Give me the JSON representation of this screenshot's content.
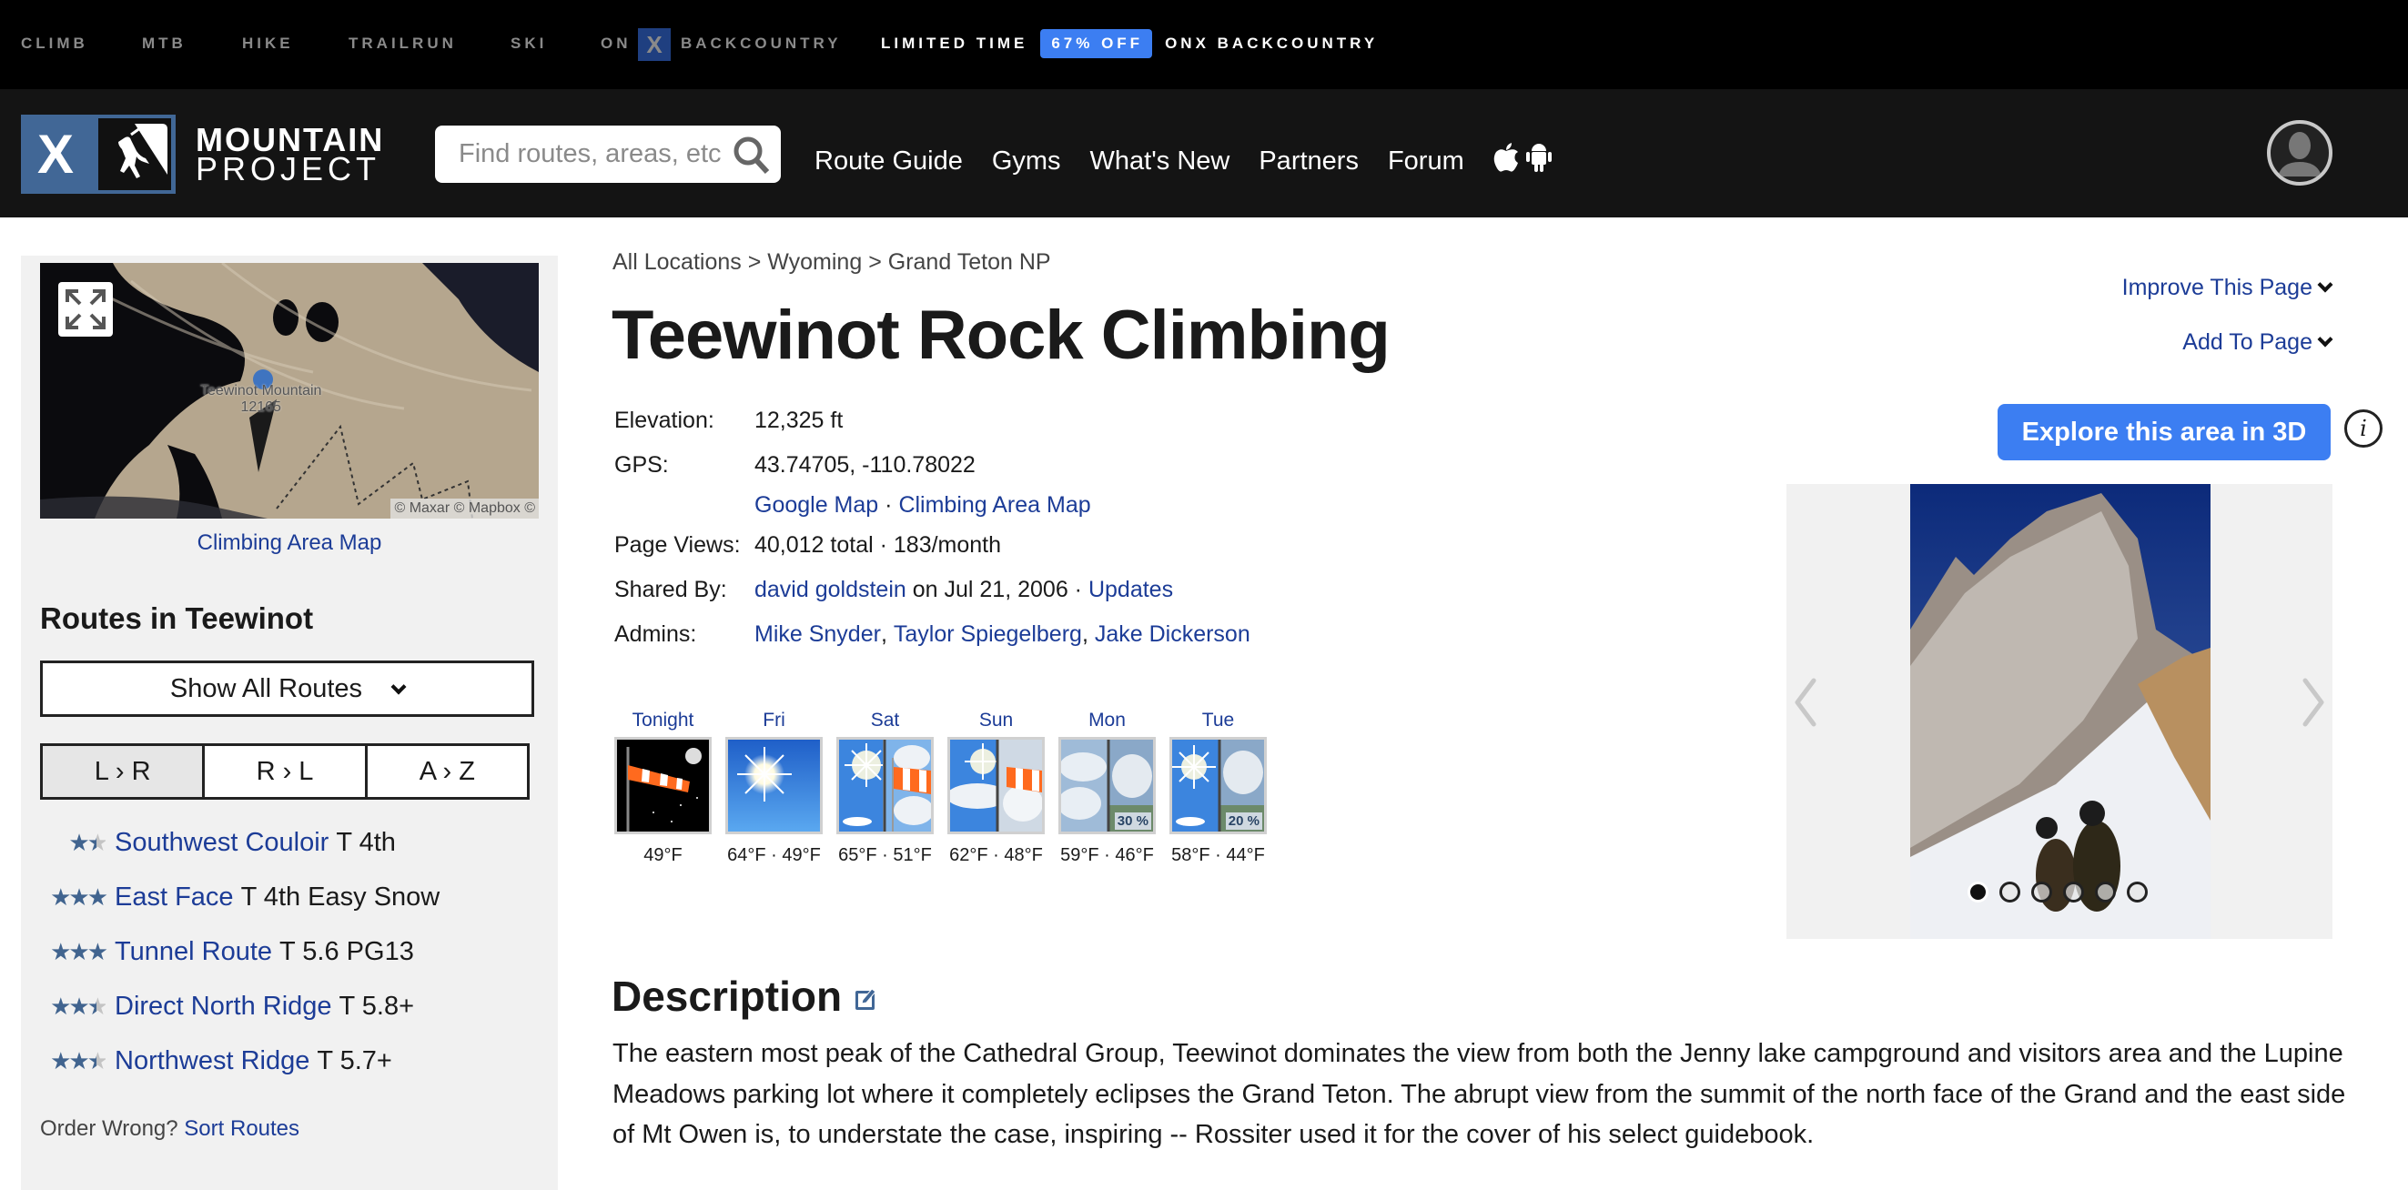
{
  "topbar": {
    "links": [
      "CLIMB",
      "MTB",
      "HIKE",
      "TRAILRUN",
      "SKI"
    ],
    "onx_prefix": "ON",
    "onx_logo": "X",
    "onx_suffix": "BACKCOUNTRY",
    "promo": {
      "before": "LIMITED TIME",
      "badge": "67% OFF",
      "after": "ONX BACKCOUNTRY"
    },
    "promo_badge_color": "#3c7ef2"
  },
  "header": {
    "logo_line1": "MOUNTAIN",
    "logo_line2": "PROJECT",
    "logo_x": "X",
    "search_placeholder": "Find routes, areas, etc",
    "search_value": "",
    "nav": [
      "Route Guide",
      "Gyms",
      "What's New",
      "Partners",
      "Forum"
    ],
    "app_icons": [
      "apple-icon",
      "android-icon"
    ]
  },
  "sidebar": {
    "map_label": "Teewinot Mountain",
    "map_label_elev": "12165",
    "map_attribution": "© Maxar © Mapbox ©",
    "map_link": "Climbing Area Map",
    "routes_heading": "Routes in Teewinot",
    "show_all": "Show All Routes",
    "sort_tabs": [
      "L › R",
      "R › L",
      "A › Z"
    ],
    "sort_active": 0,
    "routes": [
      {
        "name": "Southwest Couloir",
        "grade": "T 4th",
        "stars": 1.5
      },
      {
        "name": "East Face",
        "grade": "T 4th Easy Snow",
        "stars": 3
      },
      {
        "name": "Tunnel Route",
        "grade": "T 5.6 PG13",
        "stars": 3
      },
      {
        "name": "Direct North Ridge",
        "grade": "T 5.8+",
        "stars": 2.5
      },
      {
        "name": "Northwest Ridge",
        "grade": "T 5.7+",
        "stars": 2.5
      }
    ],
    "order_wrong": "Order Wrong?",
    "sort_routes": "Sort Routes"
  },
  "main": {
    "breadcrumb": [
      "All Locations",
      "Wyoming",
      "Grand Teton NP"
    ],
    "breadcrumb_sep": ">",
    "title": "Teewinot Rock Climbing",
    "improve": "Improve This Page",
    "add_to": "Add To Page",
    "explore_3d": "Explore this area in 3D",
    "info_icon": "i",
    "details": {
      "elevation_label": "Elevation:",
      "elevation": "12,325 ft",
      "gps_label": "GPS:",
      "gps": "43.74705, -110.78022",
      "google_map": "Google Map",
      "sep": "·",
      "climbing_map": "Climbing Area Map",
      "views_label": "Page Views:",
      "views": "40,012 total · 183/month",
      "shared_label": "Shared By:",
      "shared_user": "david goldstein",
      "shared_date": "on Jul 21, 2006 ·",
      "updates": "Updates",
      "admins_label": "Admins:",
      "admins": [
        "Mike Snyder",
        "Taylor Spiegelberg",
        "Jake Dickerson"
      ]
    },
    "weather": [
      {
        "day": "Tonight",
        "temp": "49°F",
        "icon": "night-windsock",
        "precip": ""
      },
      {
        "day": "Fri",
        "temp": "64°F · 49°F",
        "icon": "sunny",
        "precip": ""
      },
      {
        "day": "Sat",
        "temp": "65°F · 51°F",
        "icon": "sunny-windy",
        "precip": ""
      },
      {
        "day": "Sun",
        "temp": "62°F · 48°F",
        "icon": "partly-cloudy-windy",
        "precip": ""
      },
      {
        "day": "Mon",
        "temp": "59°F · 46°F",
        "icon": "cloudy-storm",
        "precip": "30 %"
      },
      {
        "day": "Tue",
        "temp": "58°F · 44°F",
        "icon": "sunny-storm",
        "precip": "20 %"
      }
    ],
    "gallery": {
      "photo_count": 6,
      "active_index": 0
    },
    "description_heading": "Description",
    "description": "The eastern most peak of the Cathedral Group, Teewinot dominates the view from both the Jenny lake campground and visitors area and the Lupine Meadows parking lot where it completely eclipses the Grand Teton. The abrupt view from the summit of the north face of the Grand and the east side of Mt Owen is, to understate the case, inspiring -- Rossiter used it for the cover of his select guidebook."
  }
}
